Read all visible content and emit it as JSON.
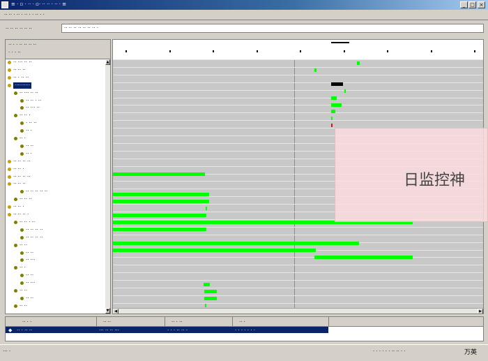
{
  "window": {
    "title": "≡ · ▫ · ·· · ▫· ·· ·· · ·· · ≡",
    "menu": "·· ·· · ·· · ·· · · ·· · ·"
  },
  "filter": {
    "label": "·· ·· ·· ·· ·· ··",
    "value": "·· ·· ·· ·· ·· ·· ·· ·"
  },
  "left_header": {
    "line1": "·· · ·   ·· ·· ·· ··",
    "line2": "· ·  ·  ··"
  },
  "tree": [
    {
      "label": "·· ··· ·· ··",
      "indent": 0,
      "icon_color": "#c8a000"
    },
    {
      "label": "·· ·· ··",
      "indent": 0,
      "icon_color": "#c8a000"
    },
    {
      "label": "·· · ·· ··",
      "indent": 0,
      "icon_color": "#c8a000"
    },
    {
      "label": "··········",
      "indent": 0,
      "icon_color": "#c8a000",
      "selected": true
    },
    {
      "label": "·· ··· ·· ··",
      "indent": 1,
      "icon_color": "#808000"
    },
    {
      "label": "·· ·· · ··",
      "indent": 2,
      "icon_color": "#808000"
    },
    {
      "label": "·· ··· ··",
      "indent": 2,
      "icon_color": "#808000"
    },
    {
      "label": "·· ·· ·",
      "indent": 1,
      "icon_color": "#808000"
    },
    {
      "label": "· ·· ··",
      "indent": 2,
      "icon_color": "#808000"
    },
    {
      "label": "·· ·",
      "indent": 2,
      "icon_color": "#808000"
    },
    {
      "label": "·· ·",
      "indent": 1,
      "icon_color": "#808000"
    },
    {
      "label": "·· ··",
      "indent": 2,
      "icon_color": "#808000"
    },
    {
      "label": "·· ·",
      "indent": 2,
      "icon_color": "#808000"
    },
    {
      "label": "·· ·· ·· ··",
      "indent": 0,
      "icon_color": "#c8a000"
    },
    {
      "label": "·· ·· ·",
      "indent": 0,
      "icon_color": "#c8a000"
    },
    {
      "label": "·· ·· ·· ··",
      "indent": 0,
      "icon_color": "#c8a000"
    },
    {
      "label": "·· ·· ··",
      "indent": 0,
      "icon_color": "#c8a000"
    },
    {
      "label": "·· ·· ·· ·· ··",
      "indent": 2,
      "icon_color": "#808000"
    },
    {
      "label": "·· ·· ··",
      "indent": 1,
      "icon_color": "#808000"
    },
    {
      "label": "·· ·· ·",
      "indent": 0,
      "icon_color": "#c8a000"
    },
    {
      "label": "·· ·· ·· ·",
      "indent": 0,
      "icon_color": "#c8a000"
    },
    {
      "label": "·· ·· · ··",
      "indent": 1,
      "icon_color": "#808000"
    },
    {
      "label": "·· ·· ·· ··",
      "indent": 2,
      "icon_color": "#808000"
    },
    {
      "label": "·· ·· ·· ··",
      "indent": 2,
      "icon_color": "#808000"
    },
    {
      "label": "·· ··",
      "indent": 1,
      "icon_color": "#808000"
    },
    {
      "label": "·· ··",
      "indent": 2,
      "icon_color": "#808000"
    },
    {
      "label": "·· ···",
      "indent": 2,
      "icon_color": "#808000"
    },
    {
      "label": "·· ·",
      "indent": 1,
      "icon_color": "#808000"
    },
    {
      "label": "·· ··",
      "indent": 2,
      "icon_color": "#808000"
    },
    {
      "label": "·· ···",
      "indent": 2,
      "icon_color": "#808000"
    },
    {
      "label": "·· ··",
      "indent": 1,
      "icon_color": "#808000"
    },
    {
      "label": "·· ··",
      "indent": 2,
      "icon_color": "#808000"
    },
    {
      "label": "·· ··",
      "indent": 1,
      "icon_color": "#808000"
    }
  ],
  "timeline": {
    "accent": "#00ff00",
    "tick_count": 9,
    "bars": [
      {
        "row": 0,
        "start": 0.66,
        "end": 0.666
      },
      {
        "row": 1,
        "start": 0.545,
        "end": 0.55
      },
      {
        "row": 3,
        "start": 0.59,
        "end": 0.622,
        "color": "#000000"
      },
      {
        "row": 4,
        "start": 0.625,
        "end": 0.629
      },
      {
        "row": 5,
        "start": 0.59,
        "end": 0.605
      },
      {
        "row": 6,
        "start": 0.59,
        "end": 0.618
      },
      {
        "row": 7,
        "start": 0.59,
        "end": 0.6
      },
      {
        "row": 8,
        "start": 0.59,
        "end": 0.594
      },
      {
        "row": 9,
        "start": 0.59,
        "end": 0.594,
        "color": "#ff0000"
      },
      {
        "row": 16,
        "start": 0.0,
        "end": 0.248
      },
      {
        "row": 19,
        "start": 0.0,
        "end": 0.26
      },
      {
        "row": 20,
        "start": 0.0,
        "end": 0.26
      },
      {
        "row": 21,
        "start": 0.25,
        "end": 0.254
      },
      {
        "row": 22,
        "start": 0.0,
        "end": 0.252
      },
      {
        "row": 23,
        "start": 0.0,
        "end": 0.81
      },
      {
        "row": 24,
        "start": 0.0,
        "end": 0.252
      },
      {
        "row": 26,
        "start": 0.0,
        "end": 0.665
      },
      {
        "row": 27,
        "start": 0.0,
        "end": 0.548
      },
      {
        "row": 28,
        "start": 0.545,
        "end": 0.81
      },
      {
        "row": 32,
        "start": 0.245,
        "end": 0.262
      },
      {
        "row": 33,
        "start": 0.247,
        "end": 0.28
      },
      {
        "row": 34,
        "start": 0.247,
        "end": 0.28
      },
      {
        "row": 35,
        "start": 0.249,
        "end": 0.253
      },
      {
        "row": 36,
        "start": 0.249,
        "end": 0.253
      },
      {
        "row": 37,
        "start": 0.252,
        "end": 0.335
      },
      {
        "row": 38,
        "start": 0.252,
        "end": 0.256
      }
    ]
  },
  "bottom_table": {
    "columns": [
      "·· · ·",
      "·· ··",
      "·· · ··",
      "·· ·"
    ],
    "row": [
      "·· · ·· ··",
      "··· ·· ··  ···",
      "· · · ·· ·· ·",
      "· · · · · · ·"
    ]
  },
  "status": {
    "left": "··· ·",
    "right": "· · · · · · ·· ·· · ·",
    "ime": "万英"
  },
  "overlay": {
    "text": "日监控神"
  }
}
